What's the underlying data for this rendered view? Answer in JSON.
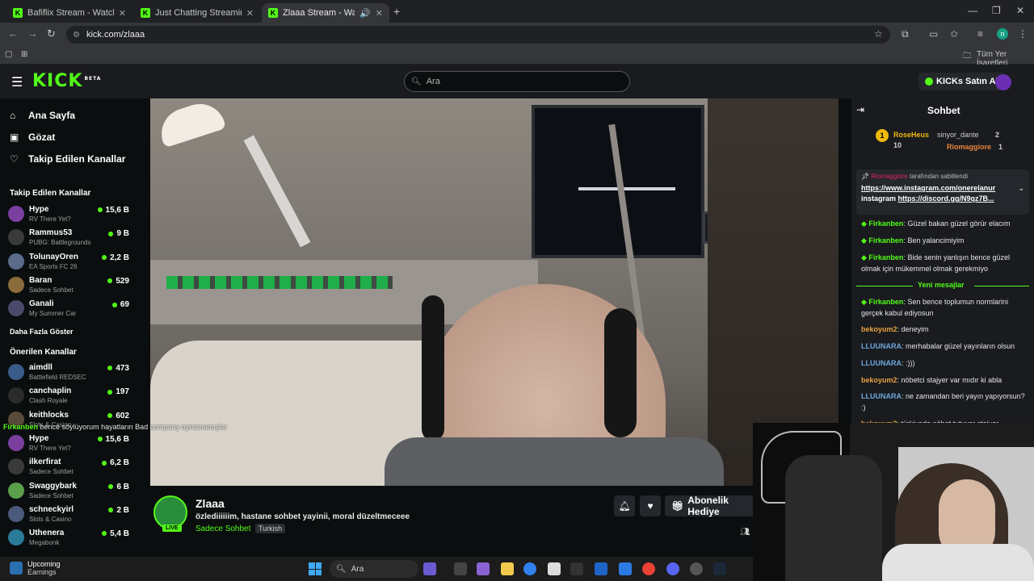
{
  "browser": {
    "tabs": [
      {
        "title": "Bafiflix Stream - Watch Live on"
      },
      {
        "title": "Just Chatting Streaming - Live S"
      },
      {
        "title": "Zlaaa Stream - Watch Live o"
      }
    ],
    "url": "kick.com/zlaaa",
    "bookmarks_all": "Tüm Yer İşaretleri",
    "profile_initial": "n"
  },
  "header": {
    "logo": "KICK",
    "logo_badge": "BETA",
    "search_placeholder": "Ara",
    "kicks_button": "KICKs Satın Al"
  },
  "sidebar": {
    "nav": [
      {
        "label": "Ana Sayfa",
        "icon": "home-icon"
      },
      {
        "label": "Gözat",
        "icon": "browse-icon"
      },
      {
        "label": "Takip Edilen Kanallar",
        "icon": "heart-icon"
      }
    ],
    "followed_title": "Takip Edilen Kanallar",
    "followed": [
      {
        "name": "Hype",
        "category": "RV There Yet?",
        "viewers": "15,6 B",
        "color": "#7b3fa0"
      },
      {
        "name": "Rammus53",
        "category": "PUBG: Battlegrounds",
        "viewers": "9 B",
        "color": "#3a3a3a"
      },
      {
        "name": "TolunayOren",
        "category": "EA Sports FC 26",
        "viewers": "2,2 B",
        "color": "#5b6b8a"
      },
      {
        "name": "Baran",
        "category": "Sadece Sohbet",
        "viewers": "529",
        "color": "#8a6b3a"
      },
      {
        "name": "Ganali",
        "category": "My Summer Car",
        "viewers": "69",
        "color": "#4a4a6a"
      }
    ],
    "show_more": "Daha Fazla Göster",
    "recommended_title": "Önerilen Kanallar",
    "recommended": [
      {
        "name": "aimdll",
        "category": "Battlefield REDSEC",
        "viewers": "473",
        "color": "#3a5a8a"
      },
      {
        "name": "canchaplin",
        "category": "Clash Royale",
        "viewers": "197",
        "color": "#2b2b2b"
      },
      {
        "name": "keithlocks",
        "category": "Slots & Casino",
        "viewers": "602",
        "color": "#5a4a3a"
      },
      {
        "name": "Hype",
        "category": "RV There Yet?",
        "viewers": "15,6 B",
        "color": "#7b3fa0"
      },
      {
        "name": "ilkerfirat",
        "category": "Sadece Sohbet",
        "viewers": "6,2 B",
        "color": "#3a3a3a"
      },
      {
        "name": "Swaggybark",
        "category": "Sadece Sohbet",
        "viewers": "6 B",
        "color": "#5aa04a"
      },
      {
        "name": "schneckyirl",
        "category": "Slots & Casino",
        "viewers": "2 B",
        "color": "#4a5a7a"
      },
      {
        "name": "Uthenera",
        "category": "Megabonk",
        "viewers": "5,4 B",
        "color": "#2a7a9a"
      }
    ],
    "overlay_message": "bence söylüyorum hayatların Bad company oynamamışlar",
    "overlay_user": "Firkanben"
  },
  "stream": {
    "name": "Zlaaa",
    "title": "özlediiiiiim, hastane sohbet yayinii, moral düzeltmeceee",
    "category": "Sadece Sohbet",
    "tag": "Turkish",
    "live_label": "LIVE",
    "subscribe_label": "Abonelik Hediye"
  },
  "chat": {
    "title": "Sohbet",
    "leaderboard": {
      "first": {
        "rank": "1",
        "name": "RoseHeus",
        "count": "10"
      },
      "second": {
        "name": "sinyor_dante",
        "count": "2"
      },
      "third": {
        "name": "Riomaggiore",
        "count": "1"
      }
    },
    "pinned": {
      "by_user": "Riomaggiore",
      "by_text": "tarafından sabitlendi",
      "link1": "https://www.instagram.com/onerelanur",
      "line2_prefix": "instagram ",
      "link2": "https://discord.gg/N9qz7B..."
    },
    "messages_before": [
      {
        "user": "Firkanben",
        "text": "Güzel bakan güzel görür elacım"
      },
      {
        "user": "Firkanben",
        "text": "Ben yalancimiyim"
      },
      {
        "user": "Firkanben",
        "text": "Bide senin yanlışın bence güzel olmak için mükemmel olmak gerekmiyo"
      }
    ],
    "new_messages_label": "Yeni mesajlar",
    "messages_after": [
      {
        "user": "Firkanben",
        "text": "Sen bence toplumun normlarini gerçek kabul ediyosun",
        "color": "#53fc18"
      },
      {
        "user": "bekoyum2",
        "text": "deneyim",
        "color": "#e6a23c"
      },
      {
        "user": "LLUUNARA",
        "text": "merhabalar güzel yayınların olsun",
        "color": "#6fa8dc"
      },
      {
        "user": "LLUUNARA",
        "text": ":)))",
        "color": "#6fa8dc"
      },
      {
        "user": "bekoyum2",
        "text": "nöbetci stajyer var mıdır ki abla",
        "color": "#e6a23c"
      },
      {
        "user": "LLUUNARA",
        "text": "ne zamandan beri yayın yapıyorsun? :)",
        "color": "#6fa8dc"
      },
      {
        "user": "bekoyum2",
        "text": "türkiyede nöbet tutuyor stajyer",
        "color": "#e6a23c"
      }
    ]
  },
  "taskbar": {
    "weather_title": "Upcoming",
    "weather_sub": "Earnings",
    "search_placeholder": "Ara"
  },
  "colors": {
    "accent": "#53fc18",
    "bg": "#0b0e0f",
    "panel": "#191b1f"
  }
}
